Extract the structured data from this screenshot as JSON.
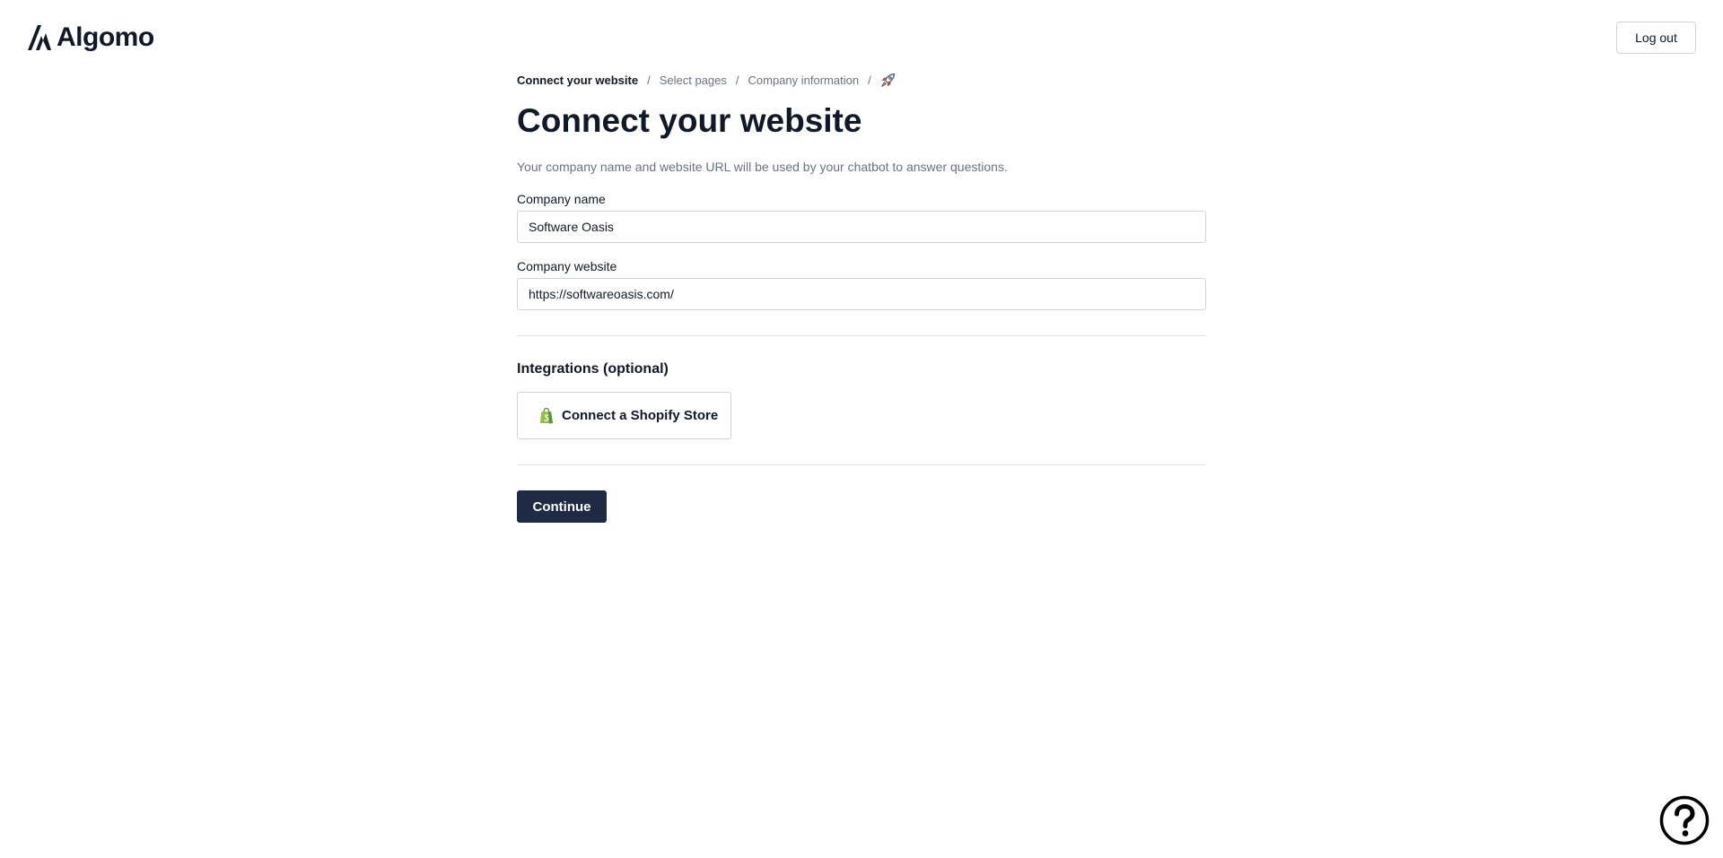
{
  "brand": {
    "name": "Algomo",
    "logo_icon": "algomo-logo-icon",
    "color": "#111827"
  },
  "header": {
    "logout_label": "Log out"
  },
  "breadcrumb": {
    "steps": [
      {
        "label": "Connect your website",
        "active": true
      },
      {
        "label": "Select pages",
        "active": false
      },
      {
        "label": "Company information",
        "active": false
      }
    ],
    "separator": "/",
    "final_icon": "rocket-icon"
  },
  "page": {
    "title": "Connect your website",
    "subtitle": "Your company name and website URL will be used by your chatbot to answer questions."
  },
  "form": {
    "company_name": {
      "label": "Company name",
      "value": "Software Oasis"
    },
    "company_website": {
      "label": "Company website",
      "value": "https://softwareoasis.com/"
    }
  },
  "integrations": {
    "title": "Integrations (optional)",
    "shopify_label": "Connect a Shopify Store",
    "shopify_icon": "shopify-bag-icon",
    "shopify_color": "#95bf47"
  },
  "actions": {
    "continue_label": "Continue",
    "primary_color": "#1f2a44"
  },
  "help": {
    "icon": "help-question-icon"
  }
}
